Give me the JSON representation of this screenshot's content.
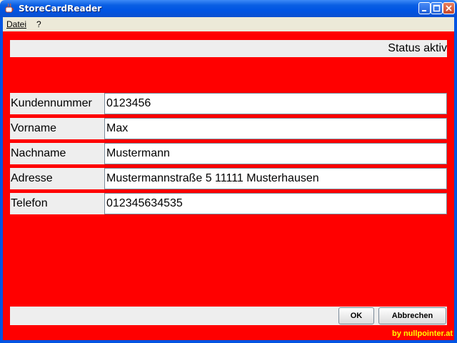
{
  "window": {
    "title": "StoreCardReader",
    "icon": "java-cup-icon",
    "controls": [
      "minimize-icon",
      "maximize-icon",
      "close-icon"
    ]
  },
  "menu": {
    "items": [
      {
        "label": "Datei"
      },
      {
        "label": "?"
      }
    ]
  },
  "status": {
    "text": "Status aktiv"
  },
  "form": {
    "fields": [
      {
        "label": "Kundennummer",
        "value": "0123456"
      },
      {
        "label": "Vorname",
        "value": "Max"
      },
      {
        "label": "Nachname",
        "value": "Mustermann"
      },
      {
        "label": "Adresse",
        "value": "Mustermannstraße 5 11111 Musterhausen"
      },
      {
        "label": "Telefon",
        "value": "012345634535"
      }
    ]
  },
  "buttons": {
    "ok_label": "OK",
    "cancel_label": "Abbrechen"
  },
  "footer": {
    "credit": "by nullpointer.at"
  },
  "colors": {
    "background": "#FF0000",
    "credit": "#FFFF00",
    "titlebar": "#0054E3"
  }
}
